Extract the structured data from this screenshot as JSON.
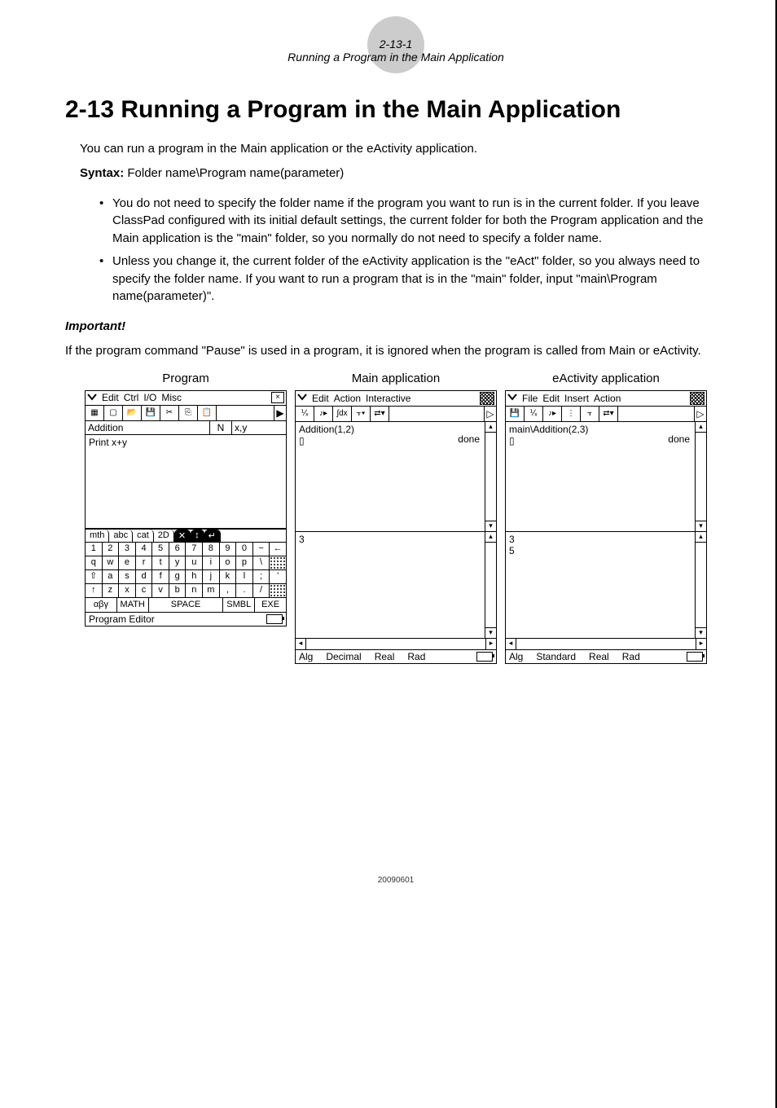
{
  "header": {
    "section_num": "2-13-1",
    "subtitle": "Running a Program in the Main Application"
  },
  "title": "2-13  Running a Program in the Main Application",
  "intro": "You can run a program in the Main application or the eActivity application.",
  "syntax_label": "Syntax:",
  "syntax_value": "Folder name\\Program name(parameter)",
  "bullets": [
    "You do not need to specify the folder name if the program you want to run is in the current folder. If you leave ClassPad configured with its initial default settings, the current folder for both the Program application and the Main application is the \"main\" folder, so you normally do not need to specify a folder name.",
    "Unless you change it, the current folder of the eActivity application is the \"eAct\" folder, so you always need to specify the folder name. If you want to run a program that is in the \"main\" folder, input \"main\\Program name(parameter)\"."
  ],
  "important_label": "Important!",
  "important_text": "If the program command \"Pause\" is used in a program, it is ignored when the program is called from Main or eActivity.",
  "columns": {
    "program": {
      "label": "Program",
      "menu": [
        "Edit",
        "Ctrl",
        "I/O",
        "Misc"
      ],
      "prog_name": "Addition",
      "prog_params_label": "N",
      "prog_params": "x,y",
      "body": "Print x+y",
      "status": "Program Editor"
    },
    "main": {
      "label": "Main application",
      "menu": [
        "Edit",
        "Action",
        "Interactive"
      ],
      "work": "Addition(1,2)",
      "done": "done",
      "result": "3",
      "status": [
        "Alg",
        "Decimal",
        "Real",
        "Rad"
      ]
    },
    "eact": {
      "label": "eActivity application",
      "menu": [
        "File",
        "Edit",
        "Insert",
        "Action"
      ],
      "work": "main\\Addition(2,3)",
      "done": "done",
      "result1": "3",
      "result2": "5",
      "status": [
        "Alg",
        "Standard",
        "Real",
        "Rad"
      ]
    }
  },
  "keyboard": {
    "tabs": [
      "mth",
      "abc",
      "cat",
      "2D"
    ],
    "row1": [
      "1",
      "2",
      "3",
      "4",
      "5",
      "6",
      "7",
      "8",
      "9",
      "0",
      "−",
      "←"
    ],
    "row2": [
      "q",
      "w",
      "e",
      "r",
      "t",
      "y",
      "u",
      "i",
      "o",
      "p",
      "\\"
    ],
    "row3": [
      "⇧",
      "a",
      "s",
      "d",
      "f",
      "g",
      "h",
      "j",
      "k",
      "l",
      ";",
      "'"
    ],
    "row4": [
      "↑",
      "z",
      "x",
      "c",
      "v",
      "b",
      "n",
      "m",
      ",",
      ".",
      "/"
    ],
    "bottom": [
      "αβγ",
      "MATH",
      "SPACE",
      "SMBL",
      "EXE"
    ]
  },
  "footer": "20090601"
}
